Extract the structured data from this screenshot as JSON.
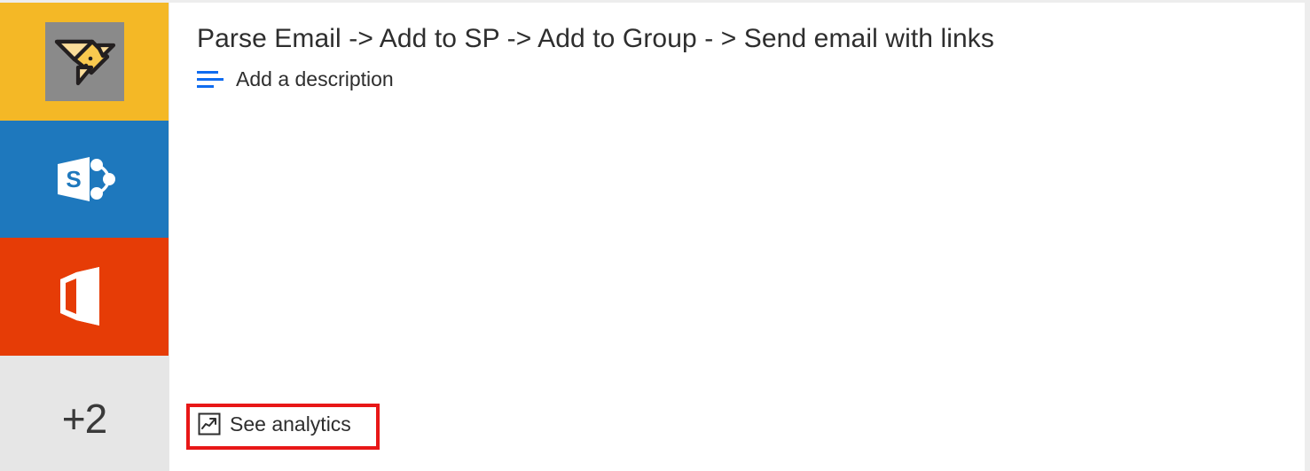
{
  "card": {
    "title": "Parse Email -> Add to SP -> Add to Group - > Send email with links",
    "description_placeholder": "Add a description",
    "description_icon": "description-lines-icon"
  },
  "connectors": {
    "tiles": [
      {
        "name": "flow",
        "label": "",
        "icon": "origami-bird-icon",
        "color": "#f4b826"
      },
      {
        "name": "sharepoint",
        "label": "",
        "icon": "sharepoint-icon",
        "color": "#1e78bd"
      },
      {
        "name": "office365",
        "label": "",
        "icon": "office-365-icon",
        "color": "#e63c06"
      },
      {
        "name": "more",
        "label": "+2",
        "icon": "",
        "color": "#e6e6e6"
      }
    ],
    "more_label": "+2"
  },
  "analytics": {
    "label": "See analytics",
    "icon": "trending-chart-icon",
    "highlight_color": "#e81717"
  },
  "colors": {
    "flow_yellow": "#f4b826",
    "sharepoint_blue": "#1e78bd",
    "office_orange": "#e63c06",
    "more_gray": "#e6e6e6",
    "icon_gray": "#8a8a8a",
    "accent_blue": "#0f6cf0",
    "text_dark": "#2e2e2e",
    "highlight_red": "#e81717"
  }
}
